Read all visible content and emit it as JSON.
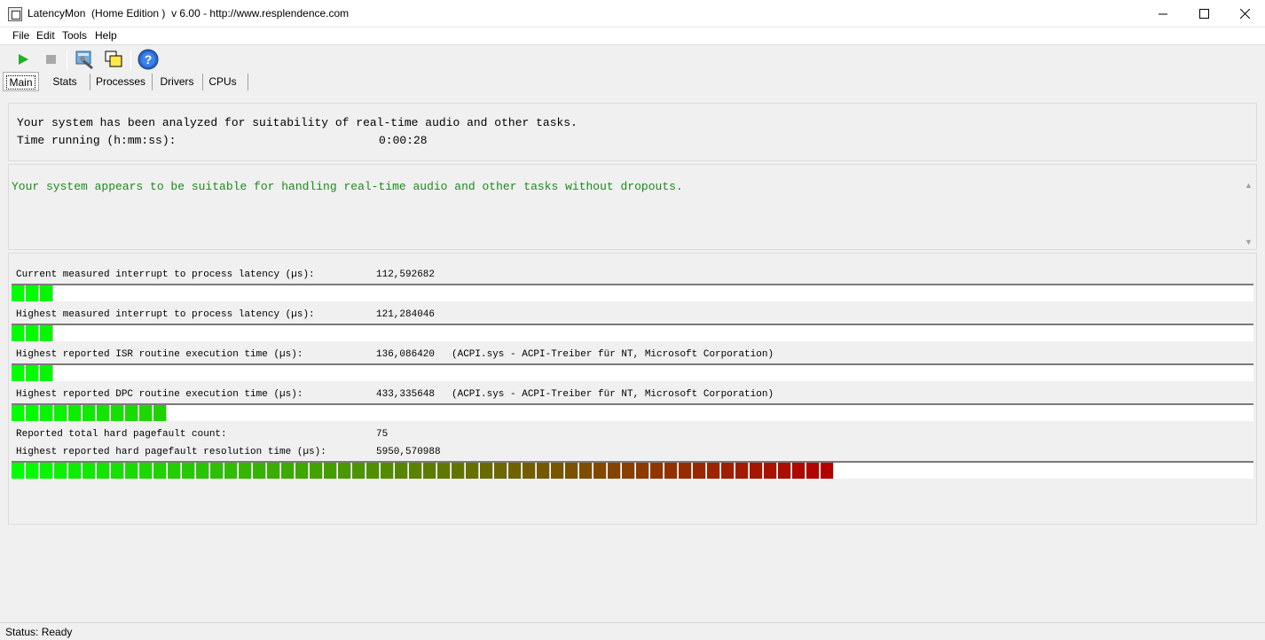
{
  "window": {
    "title": "LatencyMon  (Home Edition )  v 6.00 - http://www.resplendence.com"
  },
  "menu": [
    "File",
    "Edit",
    "Tools",
    "Help"
  ],
  "toolbar": {
    "buttons": [
      "play-icon",
      "stop-icon",
      "wrench-icon",
      "windows-icon",
      "help-icon"
    ]
  },
  "tabs": [
    "Main",
    "Stats",
    "Processes",
    "Drivers",
    "CPUs"
  ],
  "summary": {
    "analyzed_text": "Your system has been analyzed for suitability of real-time audio and other tasks.",
    "time_label": "Time running (h:mm:ss):",
    "time_value": "0:00:28"
  },
  "conclusion": "Your system appears to be suitable for handling real-time audio and other tasks without dropouts.",
  "metrics": [
    {
      "label": "Current measured interrupt to process latency (µs):",
      "value": "112,592682",
      "extra": "",
      "bar_segments": 3
    },
    {
      "label": "Highest measured interrupt to process latency (µs):",
      "value": "121,284046",
      "extra": "",
      "bar_segments": 3
    },
    {
      "label": "Highest reported ISR routine execution time (µs):",
      "value": "136,086420",
      "extra": "(ACPI.sys - ACPI-Treiber für NT, Microsoft Corporation)",
      "bar_segments": 3
    },
    {
      "label": "Highest reported DPC routine execution time (µs):",
      "value": "433,335648",
      "extra": "(ACPI.sys - ACPI-Treiber für NT, Microsoft Corporation)",
      "bar_segments": 11
    },
    {
      "label": "Reported total hard pagefault count:",
      "value": "75",
      "extra": ""
    },
    {
      "label": "Highest reported hard pagefault resolution time (µs):",
      "value": "5950,570988",
      "extra": "",
      "bar_segments": 58
    }
  ],
  "bar_colors": {
    "start": "#00ff00",
    "end": "#b50000"
  },
  "status": "Status: Ready"
}
